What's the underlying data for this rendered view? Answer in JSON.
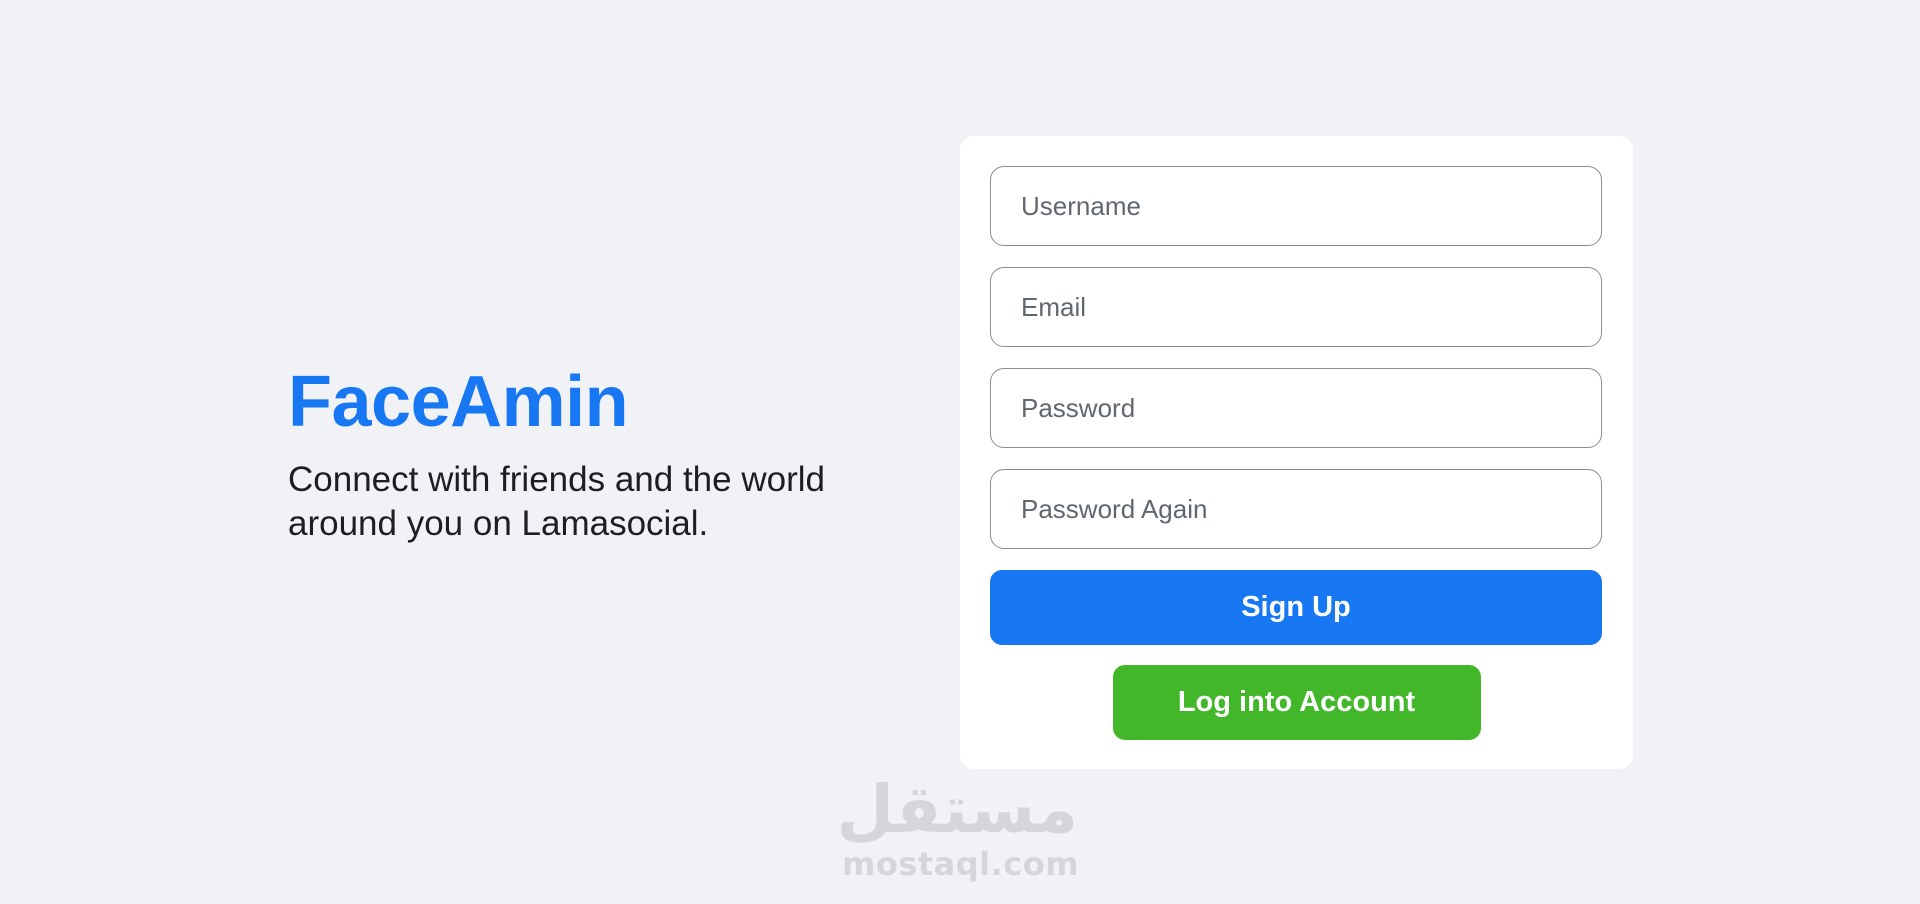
{
  "brand": {
    "title": "FaceAmin",
    "description": "Connect with friends and the world around you on Lamasocial."
  },
  "form": {
    "username": {
      "placeholder": "Username",
      "value": ""
    },
    "email": {
      "placeholder": "Email",
      "value": ""
    },
    "password": {
      "placeholder": "Password",
      "value": ""
    },
    "password_again": {
      "placeholder": "Password Again",
      "value": ""
    },
    "signup_label": "Sign Up",
    "login_label": "Log into Account"
  },
  "watermark": {
    "arabic": "مستقل",
    "latin": "mostaql.com"
  },
  "colors": {
    "background": "#f0f2f5",
    "brand": "#1877f2",
    "signup_button": "#1877f2",
    "login_button": "#42b72a",
    "card": "#ffffff"
  }
}
